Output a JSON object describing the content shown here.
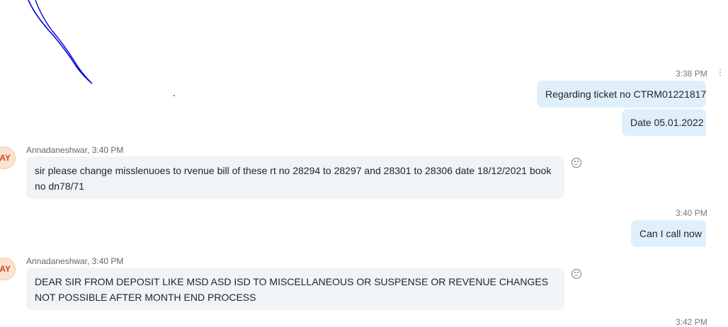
{
  "messages": {
    "out1": {
      "time": "3:38 PM",
      "lines": [
        "Regarding ticket no CTRM01221817",
        "Date 05.01.2022"
      ]
    },
    "in1": {
      "sender": "Annadaneshwar, 3:40 PM",
      "avatar": "AY",
      "text": "sir please change misslenuoes to rvenue bill of these rt no 28294 to 28297 and 28301 to 28306 date 18/12/2021 book no dn78/71"
    },
    "out2": {
      "time": "3:40 PM",
      "text": "Can I call now"
    },
    "in2": {
      "sender": "Annadaneshwar, 3:40 PM",
      "avatar": "AY",
      "text": "DEAR SIR FROM DEPOSIT LIKE MSD ASD ISD TO MISCELLANEOUS OR SUSPENSE OR REVENUE CHANGES NOT POSSIBLE AFTER MONTH END PROCESS"
    },
    "next_time_partial": "3:42 PM"
  },
  "colors": {
    "outgoing_bubble": "#dff0fc",
    "incoming_bubble": "#f1f4f7",
    "avatar_bg": "#fbe3d2",
    "avatar_text": "#c94a1b",
    "scribble": "#0000dd"
  },
  "icons": {
    "reaction": "smile-icon",
    "more": "more-options-icon"
  }
}
